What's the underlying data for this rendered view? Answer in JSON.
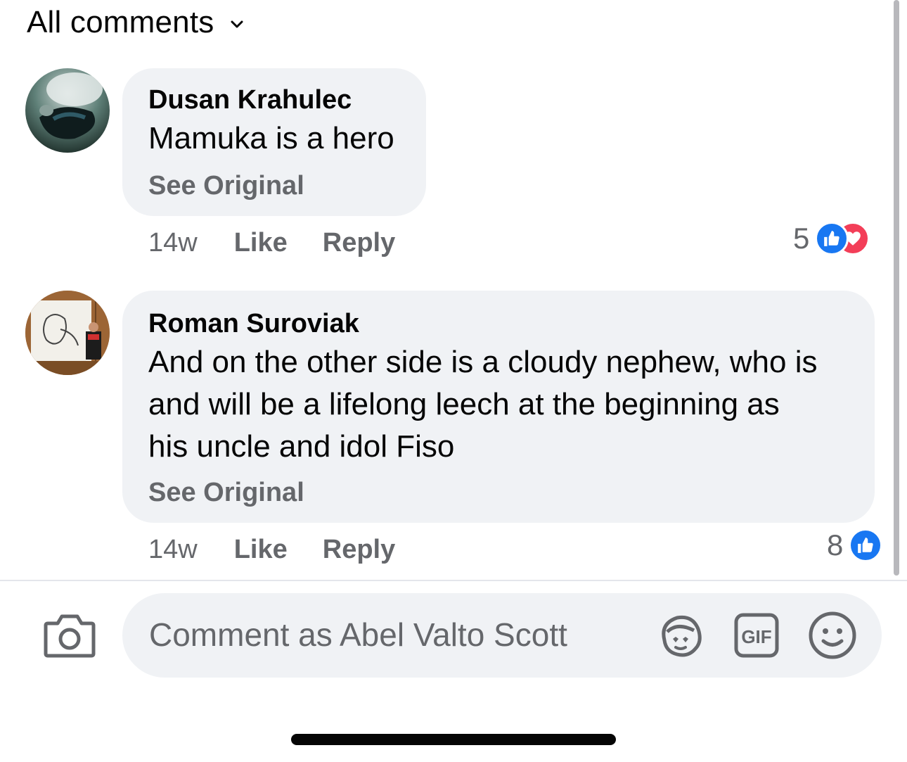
{
  "header": {
    "title": "All comments",
    "dropdown_icon": "chevron-down-icon"
  },
  "comments": [
    {
      "author": "Dusan Krahulec",
      "text": "Mamuka is a hero",
      "see_original": "See Original",
      "time": "14w",
      "like_label": "Like",
      "reply_label": "Reply",
      "reaction_count": "5",
      "reactions": [
        "like",
        "love"
      ]
    },
    {
      "author": "Roman Suroviak",
      "text_lines": [
        "And on the other side is a cloudy nephew, who is",
        "and will be a lifelong leech at the beginning as",
        "his uncle and idol Fiso"
      ],
      "see_original": "See Original",
      "time": "14w",
      "like_label": "Like",
      "reply_label": "Reply",
      "reaction_count": "8",
      "reactions": [
        "like"
      ]
    }
  ],
  "composer": {
    "placeholder": "Comment as Abel Valto Scott",
    "icons": [
      "camera-icon",
      "avatar-sticker-icon",
      "gif-icon",
      "emoji-icon"
    ],
    "gif_label": "GIF"
  },
  "colors": {
    "bubble": "#f0f2f5",
    "like_blue": "#1877f2",
    "love_red": "#f33e58",
    "secondary_text": "#65676b"
  }
}
